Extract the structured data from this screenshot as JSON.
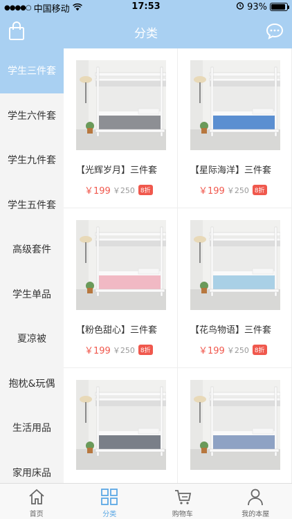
{
  "status_bar": {
    "carrier": "中国移动",
    "time": "17:53",
    "battery": "93%",
    "battery_level": 0.93
  },
  "header": {
    "title": "分类",
    "left_icon": "shopping-bag-icon",
    "right_icon": "chat-bubble-icon"
  },
  "sidebar": {
    "items": [
      {
        "label": "学生三件套",
        "active": true
      },
      {
        "label": "学生六件套"
      },
      {
        "label": "学生九件套"
      },
      {
        "label": "学生五件套"
      },
      {
        "label": "高级套件"
      },
      {
        "label": "学生单品"
      },
      {
        "label": "夏凉被"
      },
      {
        "label": "抱枕&玩偶"
      },
      {
        "label": "生活用品"
      },
      {
        "label": "家用床品"
      }
    ]
  },
  "products": [
    {
      "title": "【光辉岁月】三件套",
      "price": "￥199",
      "old_price": "￥250",
      "discount": "8折",
      "bedding_color": "#8d8f94"
    },
    {
      "title": "【星际海洋】三件套",
      "price": "￥199",
      "old_price": "￥250",
      "discount": "8折",
      "bedding_color": "#5b8fd1"
    },
    {
      "title": "【粉色甜心】三件套",
      "price": "￥199",
      "old_price": "￥250",
      "discount": "8折",
      "bedding_color": "#f1b9c4"
    },
    {
      "title": "【花鸟物语】三件套",
      "price": "￥199",
      "old_price": "￥250",
      "discount": "8折",
      "bedding_color": "#a9d0e6"
    },
    {
      "title": "",
      "price": "",
      "old_price": "",
      "discount": "",
      "bedding_color": "#7a7f88"
    },
    {
      "title": "",
      "price": "",
      "old_price": "",
      "discount": "",
      "bedding_color": "#8ea2c4"
    }
  ],
  "tabbar": {
    "items": [
      {
        "label": "首页",
        "icon": "home-icon"
      },
      {
        "label": "分类",
        "icon": "category-grid-icon",
        "active": true
      },
      {
        "label": "购物车",
        "icon": "cart-icon"
      },
      {
        "label": "我的本屋",
        "icon": "user-icon"
      }
    ]
  },
  "colors": {
    "accent": "#a9d0f2",
    "price": "#f0584d",
    "tab_active": "#5aa7e4"
  }
}
